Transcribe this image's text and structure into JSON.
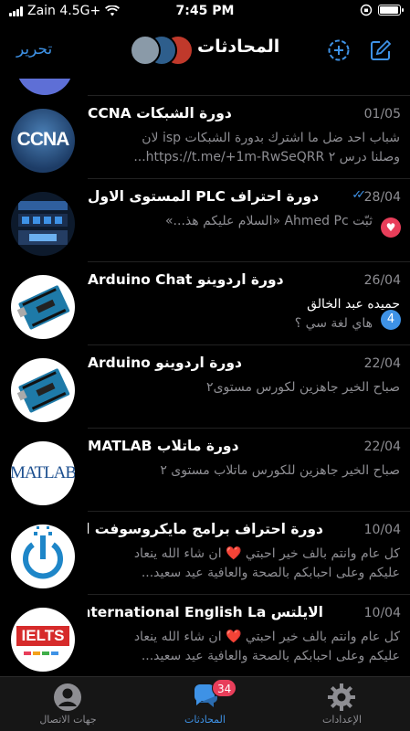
{
  "status_bar": {
    "carrier": "Zain 4.5G+",
    "time": "7:45 PM",
    "battery_level": 0.95
  },
  "nav": {
    "edit_label": "تحرير",
    "title": "المحادثات",
    "icons": [
      "compose-icon",
      "new-story-icon"
    ]
  },
  "chats": [
    {
      "title": "دورة الشبكات CCNA",
      "date": "01/05",
      "line1": "شباب احد ضل ما اشترك بدورة الشبكات isp لان",
      "line2": "وصلنا درس ٢ https://t.me/+1m-RwSeQRR...",
      "avatar": "ccna",
      "avatar_text": "CCNA"
    },
    {
      "title": "دورة احتراف PLC المستوى الاول",
      "date": "28/04",
      "line1": "ثبّت Ahmed Pc «السلام عليكم هذ...»",
      "line2": "",
      "read_checks": "✓✓",
      "mention": "♥",
      "avatar": "plc"
    },
    {
      "title": "دورة اردوينو Arduino Chat",
      "date": "26/04",
      "sender": "حميده عبد الخالق",
      "line2": "هاي لغة سي ؟",
      "unread": "4",
      "avatar": "arduino"
    },
    {
      "title": "دورة اردوينو Arduino",
      "date": "22/04",
      "line1": "صباح الخير جاهزين لكورس مستوى٢",
      "line2": "",
      "avatar": "arduino"
    },
    {
      "title": "دورة ماتلاب MATLAB",
      "date": "22/04",
      "line1": "صباح الخير جاهزين للكورس ماتلاب مستوى ٢",
      "line2": "",
      "avatar": "matlab",
      "avatar_text": "MATLAB"
    },
    {
      "title": "دورة احتراف برامج مايكروسوفت اوف",
      "date": "10/04",
      "line1": "كل عام وانتم بالف خير احبتي ❤️ ان شاء الله ينعاد",
      "line2": "عليكم وعلى احبابكم بالصحة والعافية عيد سعيد...",
      "avatar": "office"
    },
    {
      "title": "الايلتس International English La...",
      "date": "10/04",
      "line1": "كل عام وانتم بالف خير احبتي ❤️ ان شاء الله ينعاد",
      "line2": "عليكم وعلى احبابكم بالصحة والعافية عيد سعيد...",
      "avatar": "ielts",
      "avatar_text": "IELTS"
    }
  ],
  "tabs": [
    {
      "label": "جهات الاتصال",
      "icon": "contacts-icon"
    },
    {
      "label": "المحادثات",
      "icon": "chats-icon",
      "badge": "34",
      "active": true
    },
    {
      "label": "الإعدادات",
      "icon": "settings-icon"
    }
  ],
  "colors": {
    "accent": "#3e92e6",
    "badge_red": "#e83e5a",
    "background": "#000000",
    "secondary_text": "#8e8e93"
  }
}
